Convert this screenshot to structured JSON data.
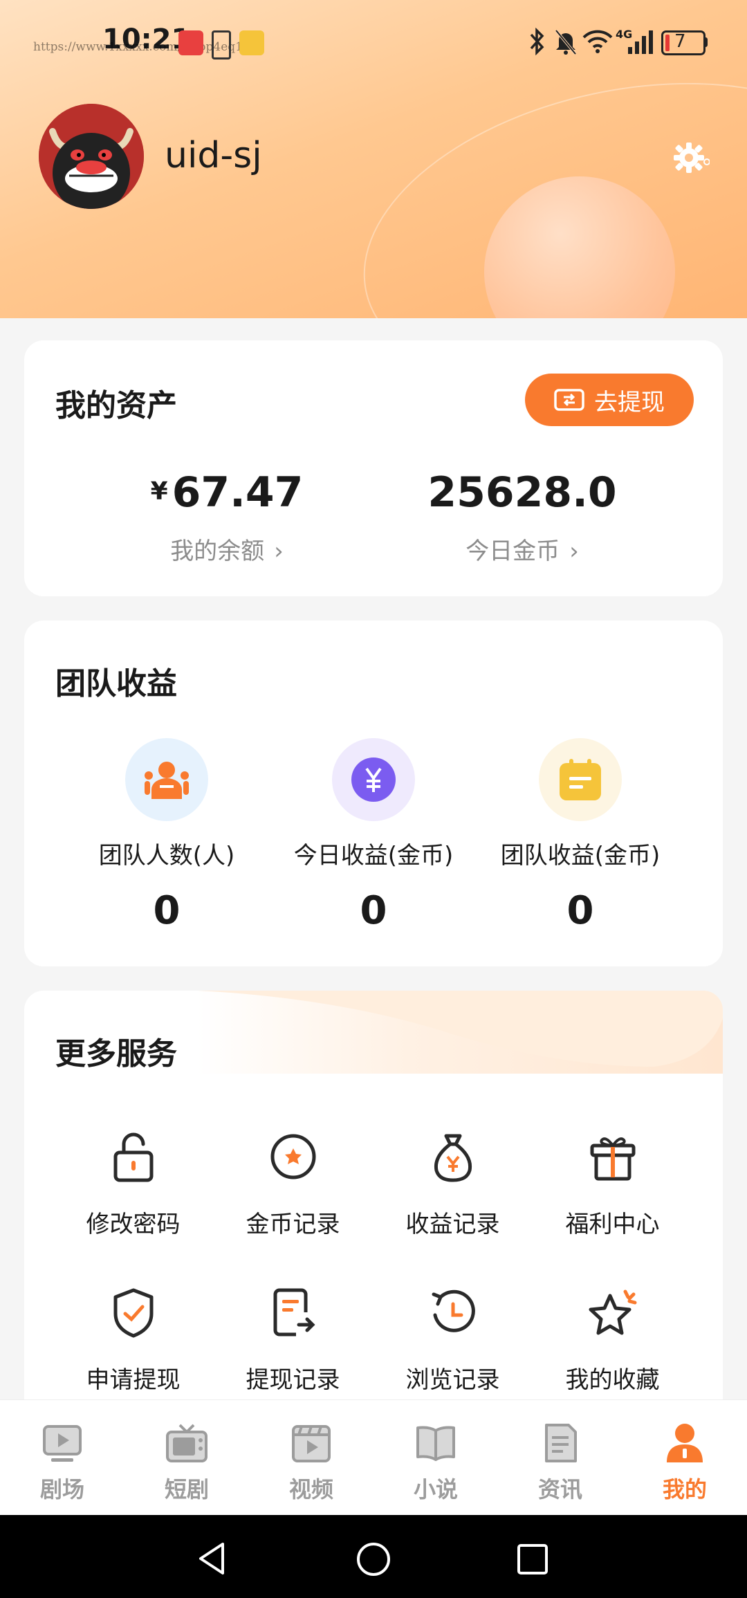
{
  "status_bar": {
    "time": "10:21",
    "watermark": "https://www.1xxxxx.com/ishop4eq13",
    "signal_label": "4G",
    "battery": "7"
  },
  "profile": {
    "username": "uid-sj"
  },
  "assets": {
    "title": "我的资产",
    "withdraw_button": "去提现",
    "balance_currency": "¥",
    "balance": "67.47",
    "balance_label": "我的余额",
    "coins_today": "25628.0",
    "coins_label": "今日金币"
  },
  "team": {
    "title": "团队收益",
    "stats": [
      {
        "label": "团队人数(人)",
        "value": "0",
        "icon": "team-people-icon"
      },
      {
        "label": "今日收益(金币)",
        "value": "0",
        "icon": "yuan-coin-icon"
      },
      {
        "label": "团队收益(金币)",
        "value": "0",
        "icon": "calendar-note-icon"
      }
    ]
  },
  "services": {
    "title": "更多服务",
    "items": [
      {
        "label": "修改密码",
        "icon": "lock-icon"
      },
      {
        "label": "金币记录",
        "icon": "coin-star-icon"
      },
      {
        "label": "收益记录",
        "icon": "money-bag-icon"
      },
      {
        "label": "福利中心",
        "icon": "gift-icon"
      },
      {
        "label": "申请提现",
        "icon": "shield-check-icon"
      },
      {
        "label": "提现记录",
        "icon": "document-export-icon"
      },
      {
        "label": "浏览记录",
        "icon": "history-clock-icon"
      },
      {
        "label": "我的收藏",
        "icon": "star-icon"
      }
    ]
  },
  "bottom_nav": {
    "items": [
      {
        "label": "剧场",
        "icon": "play-screen-icon"
      },
      {
        "label": "短剧",
        "icon": "tv-icon"
      },
      {
        "label": "视频",
        "icon": "clapper-icon"
      },
      {
        "label": "小说",
        "icon": "book-icon"
      },
      {
        "label": "资讯",
        "icon": "news-doc-icon"
      },
      {
        "label": "我的",
        "icon": "person-icon",
        "active": true
      }
    ]
  },
  "colors": {
    "accent": "#f97a2e",
    "header_gradient_start": "#ffe2c2",
    "header_gradient_end": "#ffb574",
    "purple": "#7b5cf0",
    "yellow": "#f5c43a"
  }
}
